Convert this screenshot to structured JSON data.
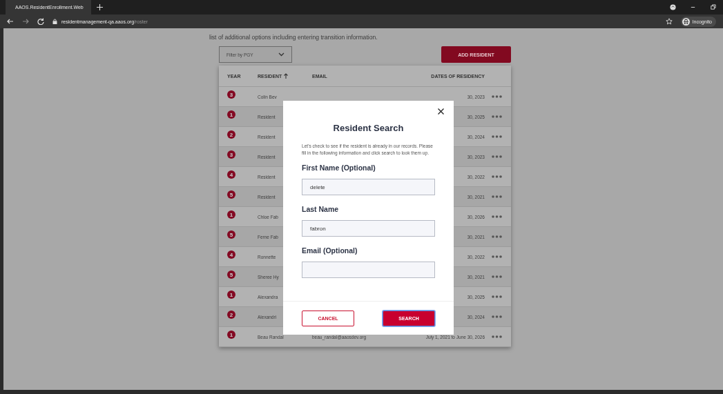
{
  "browser": {
    "tab": {
      "title": "AAOS.ResidentEnrollment.Web"
    },
    "url": {
      "host": "residentmanagement-qa.aaos.org",
      "path": "/roster"
    },
    "profile": "Incognito"
  },
  "intro": "list of additional options including entering transition information.",
  "filter": {
    "placeholder": "Filter by PGY"
  },
  "add_button": "ADD RESIDENT",
  "table": {
    "columns": [
      "YEAR",
      "RESIDENT",
      "EMAIL",
      "DATES OF RESIDENCY"
    ],
    "rows": [
      {
        "year": "3",
        "resident": "Colin Bev",
        "dates": "30, 2023"
      },
      {
        "year": "1",
        "resident": "Resident",
        "dates": "30, 2025"
      },
      {
        "year": "2",
        "resident": "Resident",
        "dates": "30, 2024"
      },
      {
        "year": "3",
        "resident": "Resident",
        "dates": "30, 2023"
      },
      {
        "year": "4",
        "resident": "Resident",
        "dates": "30, 2022"
      },
      {
        "year": "5",
        "resident": "Resident",
        "dates": "30, 2021"
      },
      {
        "year": "1",
        "resident": "Chloe Fab",
        "dates": "30, 2026"
      },
      {
        "year": "5",
        "resident": "Ferne Fab",
        "dates": "30, 2021"
      },
      {
        "year": "4",
        "resident": "Ronnette",
        "dates": "30, 2022"
      },
      {
        "year": "5",
        "resident": "Sheree Hy",
        "dates": "30, 2021"
      },
      {
        "year": "1",
        "resident": "Alexandra",
        "dates": "30, 2025"
      },
      {
        "year": "2",
        "resident": "Alexandri",
        "dates": "30, 2024"
      },
      {
        "year": "1",
        "resident": "Beau Randal",
        "email": "beau_randal@aaosdev.org",
        "dates": "July 1, 2021 to June 30, 2026"
      }
    ]
  },
  "modal": {
    "title": "Resident Search",
    "text": "Let's check to see if the resident is already in our records. Please fill in the following information and click search to look them up.",
    "fields": [
      {
        "label": "First Name (Optional)",
        "value": "delete"
      },
      {
        "label": "Last Name",
        "value": "fabron"
      },
      {
        "label": "Email (Optional)"
      }
    ],
    "cancel": "CANCEL",
    "search": "SEARCH"
  }
}
